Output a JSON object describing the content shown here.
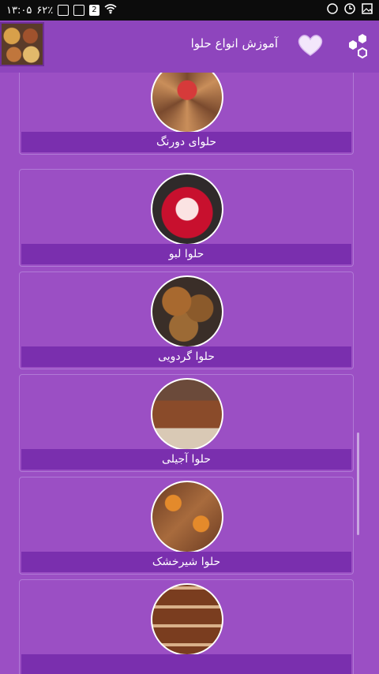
{
  "status_bar": {
    "time": "۱۳:۰۵",
    "battery": "۶۲٪",
    "notification_count": "2"
  },
  "app_bar": {
    "title": "آموزش انواع حلوا"
  },
  "items": [
    {
      "label": "حلوای دورنگ"
    },
    {
      "label": "حلوا لبو"
    },
    {
      "label": "حلوا گردویی"
    },
    {
      "label": "حلوا آجیلی"
    },
    {
      "label": "حلوا شیرخشک"
    },
    {
      "label": ""
    }
  ],
  "colors": {
    "background": "#9b4fc4",
    "app_bar": "#8e45bd",
    "label_bar": "#7a2fae"
  }
}
